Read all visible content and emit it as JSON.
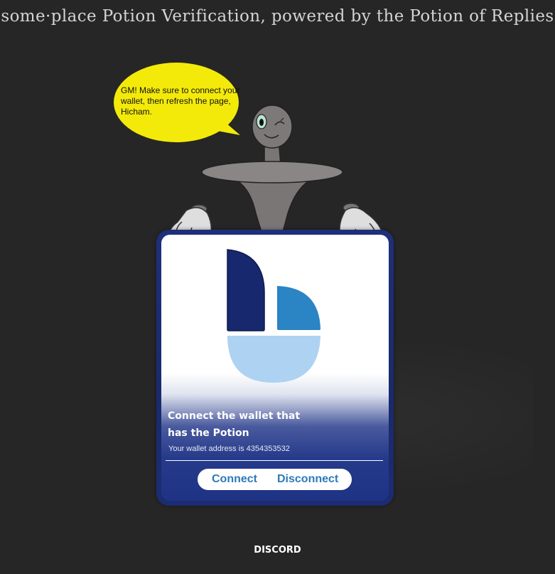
{
  "header": {
    "title": "some·place Potion Verification, powered by the Potion of Replies"
  },
  "mascot": {
    "speech": "GM! Make sure to connect your wallet, then refresh the page, Hicham.",
    "bubble_color": "#f4ea09"
  },
  "card": {
    "heading": "Connect the wallet that has the Potion",
    "wallet_address": "Your wallet address is 4354353532",
    "connect_label": "Connect",
    "disconnect_label": "Disconnect",
    "frame_color": "#1f2f7a",
    "button_text_color": "#2e7ab8"
  },
  "logo": {
    "colors": {
      "dark": "#17286e",
      "mid": "#2b84c4",
      "light": "#aed2f1"
    }
  },
  "footer": {
    "link_label": "DISCORD"
  }
}
